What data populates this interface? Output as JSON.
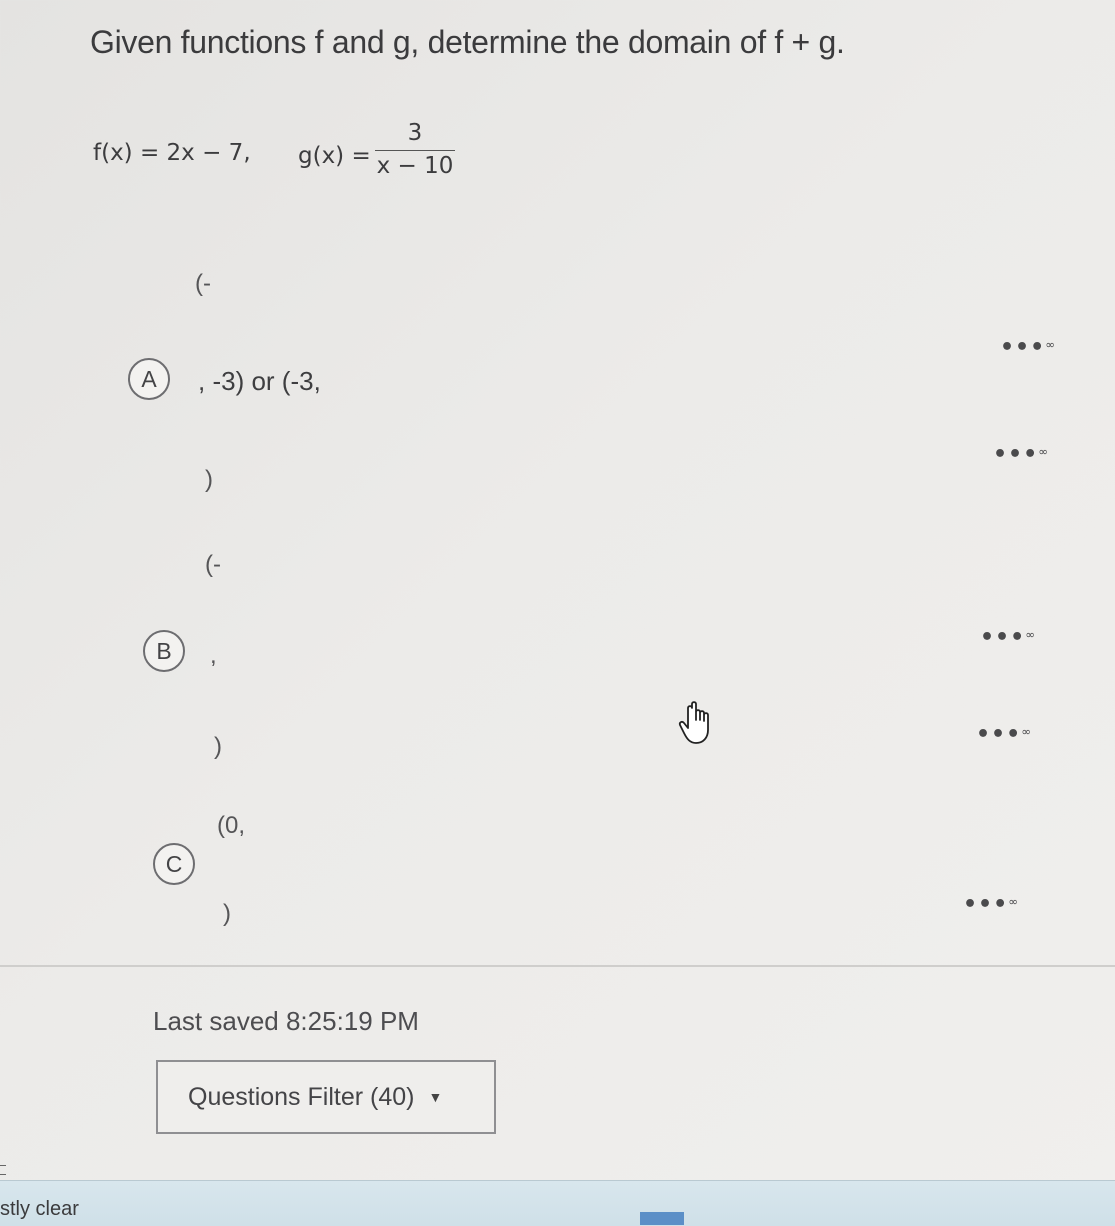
{
  "question": {
    "title": "Given functions f and g, determine the domain of f + g.",
    "f_def": "f(x) = 2x − 7,",
    "g_lhs": "g(x) =",
    "g_numerator": "3",
    "g_denominator": "x − 10"
  },
  "choices": [
    {
      "letter": "A",
      "top": "(-",
      "middle": ", -3) or (-3,",
      "bottom": ")"
    },
    {
      "letter": "B",
      "top": "(-",
      "middle": ",",
      "bottom": ")"
    },
    {
      "letter": "C",
      "top": "(0,",
      "bottom": ")"
    }
  ],
  "infinity_glyph": "∞",
  "dots_glyph": "•••",
  "footer": {
    "last_saved": "Last saved 8:25:19 PM",
    "filter_label": "Questions Filter (40)",
    "filter_caret": "▼"
  },
  "taskbar": {
    "weather_text": "stly clear"
  },
  "icons": {
    "cursor": "hand-pointer-icon",
    "dropdown": "caret-down-icon"
  }
}
